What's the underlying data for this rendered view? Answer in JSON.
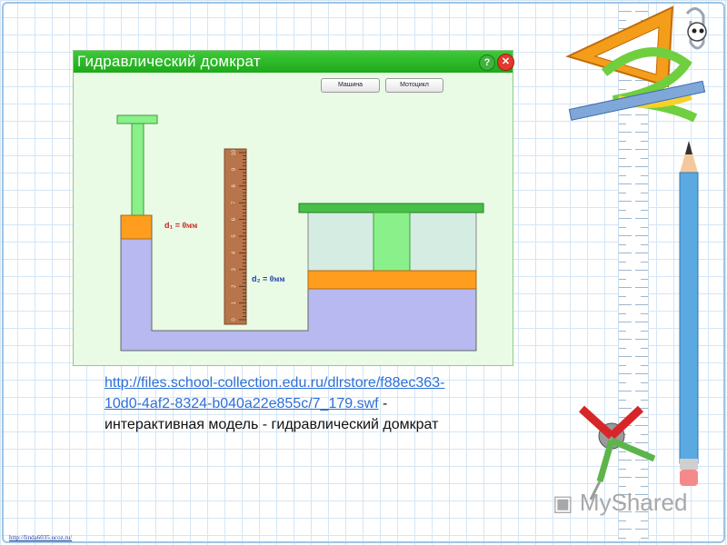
{
  "app": {
    "title": "Гидравлический домкрат",
    "help_label": "?",
    "close_label": "✕",
    "buttons": [
      "Машина",
      "Мотоцикл"
    ],
    "d1_label": "d₁ =",
    "d1_value": "0мм",
    "d2_label": "d₂ =",
    "d2_value": "0мм",
    "ruler_numbers": [
      "0",
      "1",
      "2",
      "3",
      "4",
      "5",
      "6",
      "7",
      "8",
      "9",
      "10"
    ]
  },
  "caption": {
    "url": "http://files.school-collection.edu.ru/dlrstore/f88ec363-10d0-4af2-8324-b040a22e855c/7_179.swf",
    "url_line1": "http://files.school-collection.edu.ru/dlrstore/f88ec363-",
    "url_line2": "10d0-4af2-8324-b040a22e855c/7_179.swf",
    "separator": " -",
    "text": "интерактивная модель - гидравлический домкрат"
  },
  "footer_link": "http://linda6035.ucoz.ru/",
  "logo_text": "MyShared",
  "colors": {
    "title_bar": "#27b322",
    "water": "#b7b9f0",
    "piston_orange": "#ff9d1e",
    "piston_green": "#8af08a",
    "ruler": "#b8744a"
  }
}
